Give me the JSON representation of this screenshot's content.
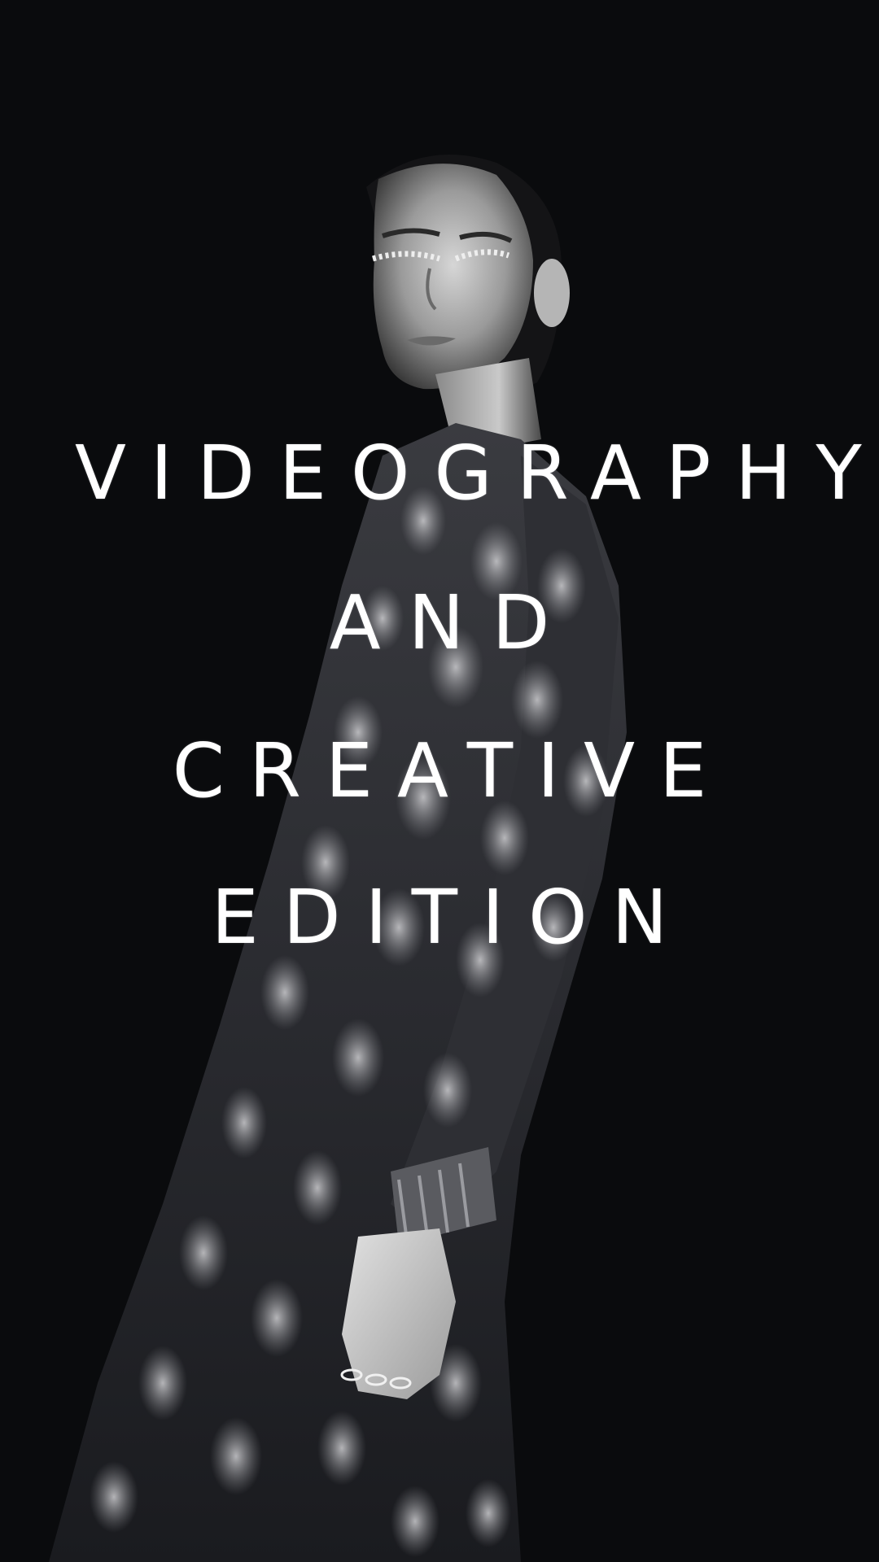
{
  "poster": {
    "title_lines": [
      "VIDEOGRAPHY",
      "AND",
      "CREATIVE",
      "EDITION"
    ]
  },
  "colors": {
    "background": "#0a0b0d",
    "text": "#ffffff"
  }
}
